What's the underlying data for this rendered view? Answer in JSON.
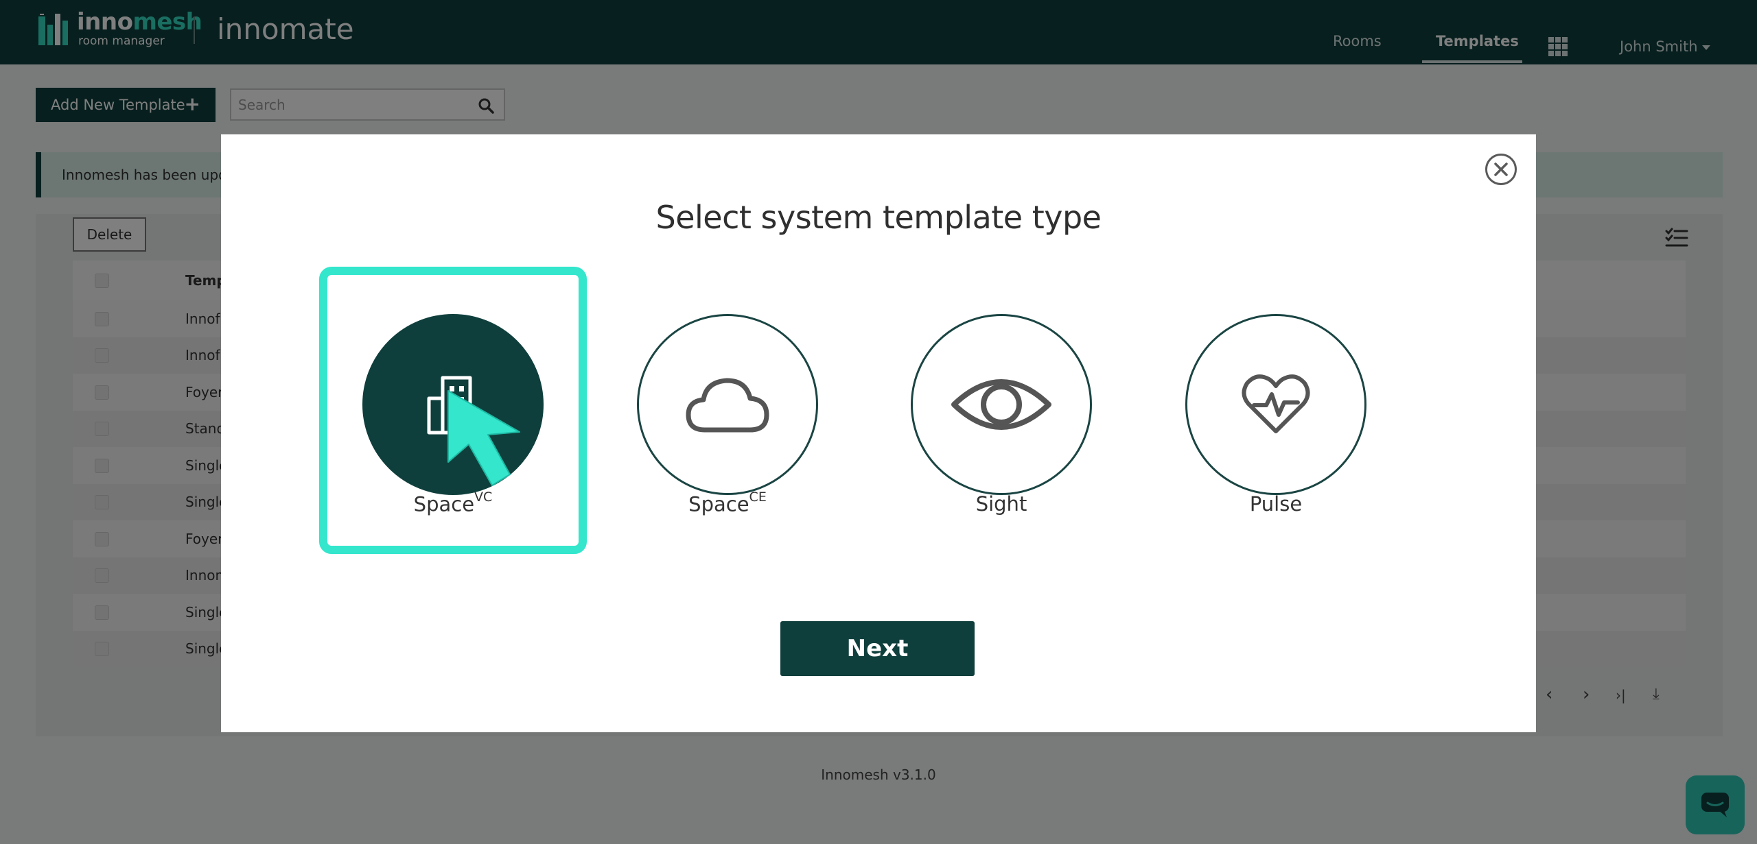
{
  "navbar": {
    "logo": {
      "word_main": "inno",
      "word_accent": "mesh",
      "subtitle": "room manager"
    },
    "brand": "innomate",
    "nav_items": [
      {
        "label": "Rooms",
        "active": false
      },
      {
        "label": "Templates",
        "active": true
      }
    ],
    "apps_icon": "grid-icon",
    "user_name": "John Smith"
  },
  "toolbar": {
    "add_button_label": "Add New Template",
    "add_button_icon": "+",
    "search_placeholder": "Search",
    "search_value": ""
  },
  "alert": {
    "text": "Innomesh has been upda"
  },
  "table": {
    "delete_label": "Delete",
    "header": "Temp",
    "rows": [
      "Innof",
      "Innof",
      "Foyer",
      "Stand",
      "Single",
      "Single",
      "Foyer",
      "Innom",
      "Single",
      "Single"
    ],
    "pager": {
      "prev": "‹",
      "next": "›",
      "last": "›|",
      "download": "⤓"
    }
  },
  "footer": {
    "version": "Innomesh v3.1.0"
  },
  "modal": {
    "title": "Select system template type",
    "options": [
      {
        "name": "Space",
        "sup": "VC",
        "icon": "building-icon",
        "selected": true
      },
      {
        "name": "Space",
        "sup": "CE",
        "icon": "cloud-icon",
        "selected": false
      },
      {
        "name": "Sight",
        "sup": "",
        "icon": "eye-icon",
        "selected": false
      },
      {
        "name": "Pulse",
        "sup": "",
        "icon": "heart-pulse-icon",
        "selected": false
      }
    ],
    "next_label": "Next"
  },
  "colors": {
    "brand_dark": "#0f3f3c",
    "accent": "#33ddc3",
    "selection": "#33e6cc",
    "chat": "#2fc8b6"
  }
}
